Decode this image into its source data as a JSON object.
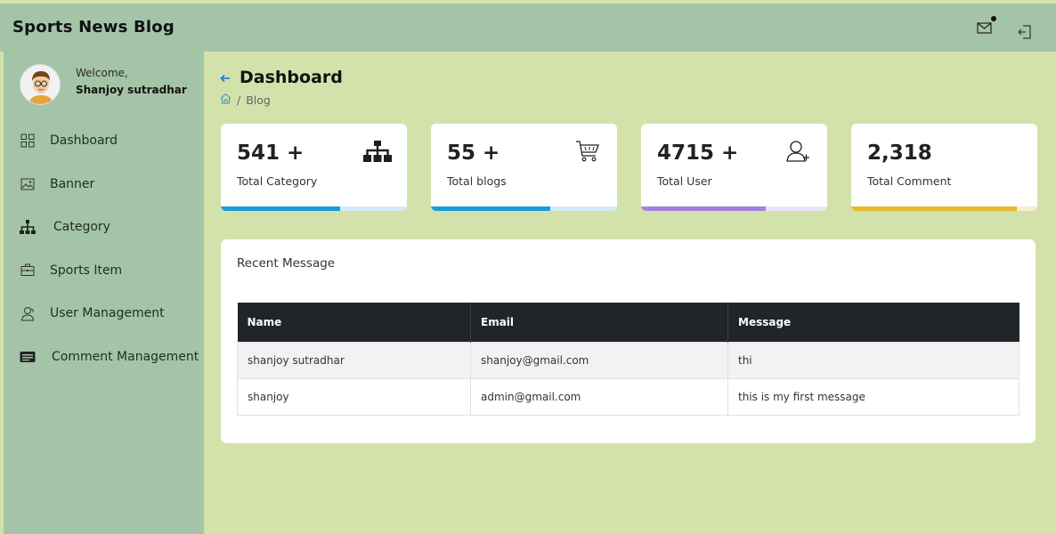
{
  "app": {
    "brand": "Sports News Blog"
  },
  "sidebar": {
    "welcome": "Welcome,",
    "username": "Shanjoy sutradhar",
    "items": [
      {
        "label": "Dashboard",
        "icon": "grid-icon"
      },
      {
        "label": "Banner",
        "icon": "image-icon"
      },
      {
        "label": "Category",
        "icon": "sitemap-icon"
      },
      {
        "label": "Sports Item",
        "icon": "briefcase-icon"
      },
      {
        "label": "User Management",
        "icon": "users-icon"
      },
      {
        "label": "Comment Management",
        "icon": "card-icon"
      }
    ]
  },
  "header": {
    "title": "Dashboard",
    "breadcrumb": {
      "sep": "/",
      "current": "Blog"
    }
  },
  "cards": [
    {
      "value": "541 +",
      "label": "Total Category",
      "icon": "sitemap-icon",
      "progress": 0.64,
      "color": "#1a9bd7",
      "track": "#d1ecf6"
    },
    {
      "value": "55 +",
      "label": "Total blogs",
      "icon": "cart-icon",
      "progress": 0.64,
      "color": "#1a9bd7",
      "track": "#d1ecf6"
    },
    {
      "value": "4715 +",
      "label": "Total User",
      "icon": "add-user-icon",
      "progress": 0.67,
      "color": "#a47ee0",
      "track": "#ebe3f7"
    },
    {
      "value": "2,318",
      "label": "Total Comment",
      "icon": "",
      "progress": 0.89,
      "color": "#e8b92e",
      "track": "#f8efd1"
    }
  ],
  "messages": {
    "title": "Recent Message",
    "columns": [
      "Name",
      "Email",
      "Message"
    ],
    "rows": [
      [
        "shanjoy sutradhar",
        "shanjoy@gmail.com",
        "thi"
      ],
      [
        "shanjoy",
        "admin@gmail.com",
        "this is my first message"
      ]
    ]
  },
  "colors": {
    "sidebar": "#a4c4a8",
    "background": "#d3e2ab",
    "accent": "#1a73e8"
  }
}
